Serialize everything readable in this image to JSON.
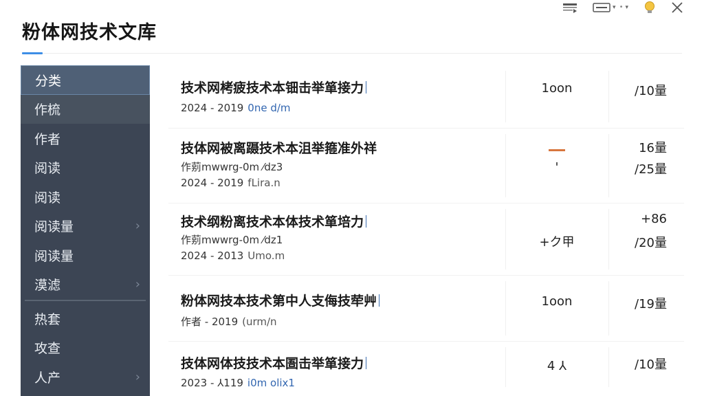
{
  "app": {
    "title": "粉体网技术文库"
  },
  "toolbar": {
    "caret": "▾"
  },
  "sidebar": {
    "items": [
      {
        "label": "分类",
        "chevron": ""
      },
      {
        "label": "作梳",
        "chevron": ""
      },
      {
        "label": "作者",
        "chevron": ""
      },
      {
        "label": "阅读",
        "chevron": ""
      },
      {
        "label": "阅读",
        "chevron": ""
      },
      {
        "label": "阅读量",
        "chevron": "›"
      },
      {
        "label": "阅读量",
        "chevron": ""
      },
      {
        "label": "漠滤",
        "chevron": "›"
      },
      {
        "label": "热套",
        "chevron": ""
      },
      {
        "label": "攻查",
        "chevron": ""
      },
      {
        "label": "人产",
        "chevron": "›"
      }
    ]
  },
  "list": {
    "rows": [
      {
        "title": "技术网栲疲技术本钿击举箪接力",
        "line1_text": "",
        "line1_meta": "",
        "line2_text": "2024 - 2019",
        "line2_meta": "0ne d/m",
        "col2": "1oon",
        "col2_dash": false,
        "col3_top": "",
        "col3_bottom": "/10量"
      },
      {
        "title": "技体网被离蹑技术本沮举箍准外祥",
        "line1_text": "作莂mwwrg-0m ⁄dz3",
        "line1_meta": "",
        "line2_text": "2024 - 2019",
        "line2_meta": "fLira.n",
        "col2": "'",
        "col2_dash": true,
        "col3_top": "16量",
        "col3_bottom": "/25量"
      },
      {
        "title": "技术纲粉离技术本体技术箪培力",
        "line1_text": "作莂mwwrg-0m ⁄dz1",
        "line1_meta": "",
        "line2_text": "2024 - 2013",
        "line2_meta": "Umo.m",
        "col2": "+ク甲",
        "col2_dash": false,
        "col3_top": "+86",
        "col3_bottom": "/20量"
      },
      {
        "title": "粉体网技本技术第中人支侮技荦艸",
        "line1_text": "",
        "line1_meta": "",
        "line2_text": "作者 - 2019",
        "line2_meta": "(urm/n",
        "col2": "1oon",
        "col2_dash": false,
        "col3_top": "",
        "col3_bottom": "/19量"
      },
      {
        "title": "技体网体技技术本圄击举箪接力",
        "line1_text": "",
        "line1_meta": "",
        "line2_text": "2023 - ⅄119",
        "line2_meta": "i0m olix1",
        "col2": "4 ⅄",
        "col2_dash": false,
        "col3_top": "",
        "col3_bottom": "/10量"
      }
    ]
  }
}
